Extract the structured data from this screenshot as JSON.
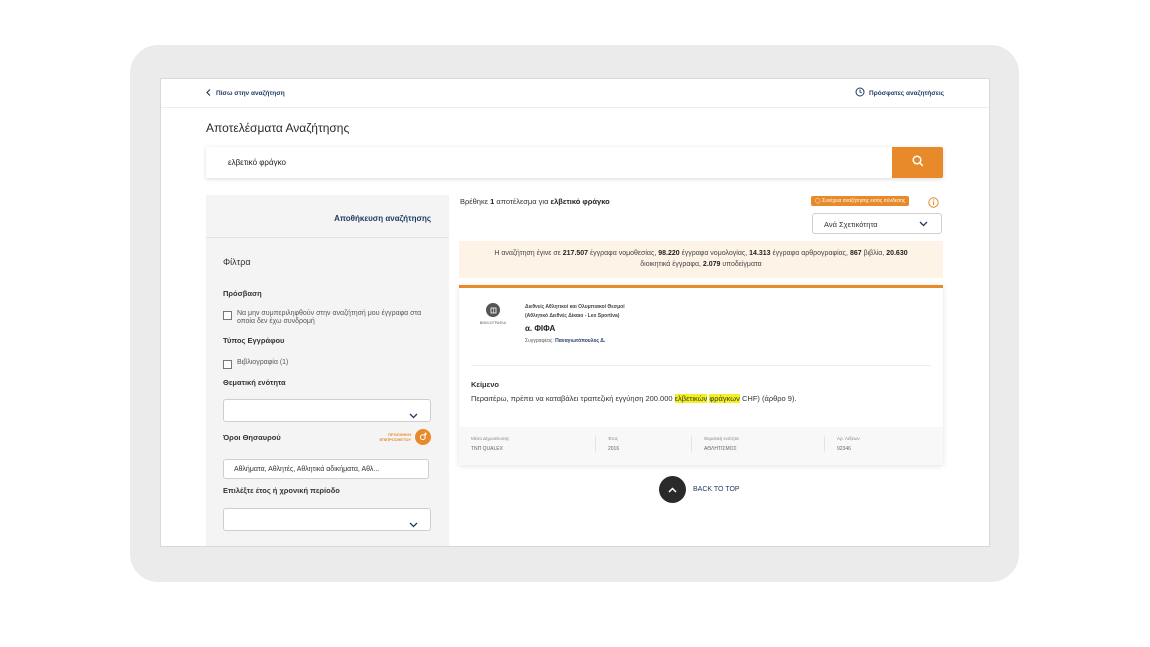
{
  "topbar": {
    "back_label": "Πίσω στην αναζήτηση",
    "recent_label": "Πρόσφατες αναζητήσεις"
  },
  "page": {
    "title": "Αποτελέσματα Αναζήτησης"
  },
  "search": {
    "value": "ελβετικό φράγκο"
  },
  "sidebar": {
    "save_search": "Αποθήκευση αναζήτησης",
    "filters_title": "Φίλτρα",
    "access_label": "Πρόσβαση",
    "access_option": "Να μην συμπεριληφθούν στην αναζήτησή μου έγγραφα στα οποία δεν έχω συνδρομή",
    "doc_type_label": "Τύπος Εγγράφου",
    "doc_type_option": "Βιβλιογραφία (1)",
    "topic_label": "Θεματική ενότητα",
    "thesaurus_label": "Όροι Θησαυρού",
    "thesaurus_badge": "ΠΡΟΣΘΗΚΗ ΕΠΙΠΡΟΣΘΕΤΟΥ",
    "thesaurus_value": "Αθλήματα, Αθλητές, Αθλητικά αδικήματα, Αθλ...",
    "period_label": "Επιλέξτε έτος ή χρονική περίοδο"
  },
  "results": {
    "count_prefix": "Βρέθηκε",
    "count": "1",
    "count_mid": "αποτέλεσμα για",
    "query": "ελβετικό φράγκο",
    "alert_label": "Συνέχεια αναζήτησης εκτός σύνδεσης",
    "sort_value": "Ανά Σχετικότητα",
    "stats": {
      "s1": "Η αναζήτηση έγινε σε",
      "n1": "217.507",
      "s2": "έγγραφα νομοθεσίας,",
      "n2": "98.220",
      "s3": "έγγραφα νομολογίας,",
      "n3": "14.313",
      "s4": "έγγραφα αρθρογραφίας,",
      "n4": "867",
      "s5": "βιβλία,",
      "n5": "20.630",
      "s6": "διοικητικά έγγραφα,",
      "n6": "2.079",
      "s7": "υποδείγματα"
    }
  },
  "card": {
    "category": "ΒΙΒΛΙΟΓΡΑΦΙΑ",
    "breadcrumb": "Διεθνείς Αθλητικοί και Ολυμπιακοί Θεσμοί",
    "breadcrumb2": "(Αθλητικό Διεθνές Δίκαιο - Lex Sportiva)",
    "title": "α. ΦΙΦΑ",
    "author_label": "Συγγραφέας:",
    "author": "Παναγιωτόπουλος Δ.",
    "section_label": "Κείμενο",
    "snippet_pre": "Περαιτέρω, πρέπει να καταβάλει τραπεζική εγγύηση 200.000",
    "snippet_hl1": "ελβετικών",
    "snippet_hl2": "φράγκων",
    "snippet_post": "CHF) (άρθρο 9).",
    "meta": [
      {
        "label": "Μέσο Δημοσίευσης",
        "value": "ΤΝΠ QUALEX"
      },
      {
        "label": "Έτος",
        "value": "2016"
      },
      {
        "label": "Θεματική ενότητα",
        "value": "ΑΘΛΗΤΙΣΜΟΣ"
      },
      {
        "label": "Αρ. Λέξεων",
        "value": "92346"
      }
    ]
  },
  "back_to_top": "BACK TO TOP",
  "colors": {
    "accent": "#e8892a",
    "navy": "#1f3b63",
    "highlight": "#f4f21e"
  }
}
